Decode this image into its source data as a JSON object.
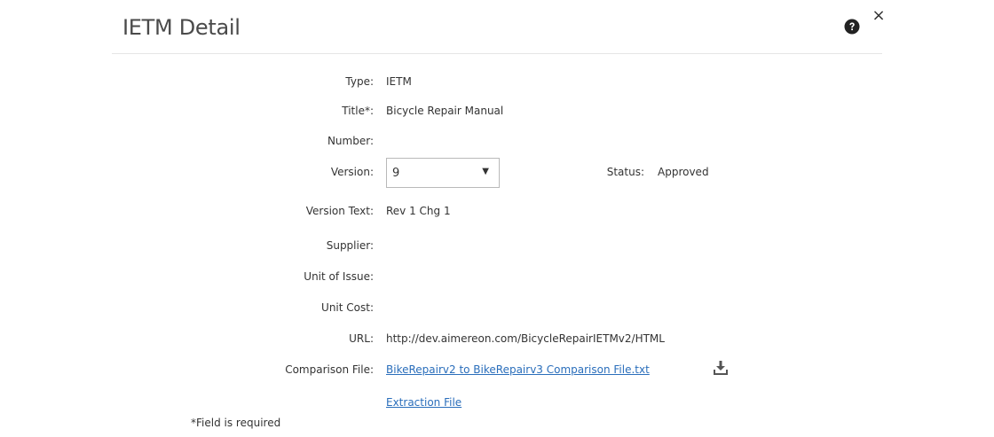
{
  "modal": {
    "title": "IETM Detail",
    "icons": {
      "help": "question-circle-icon",
      "close": "close-icon",
      "download": "download-icon"
    },
    "close_glyph": "×"
  },
  "fields": {
    "type": {
      "label": "Type:",
      "value": "IETM"
    },
    "title": {
      "label": "Title*:",
      "value": "Bicycle Repair Manual"
    },
    "number": {
      "label": "Number:",
      "value": ""
    },
    "version": {
      "label": "Version:",
      "value": "9"
    },
    "status": {
      "label": "Status:",
      "value": "Approved"
    },
    "version_text": {
      "label": "Version Text:",
      "value": "Rev 1 Chg 1"
    },
    "supplier": {
      "label": "Supplier:",
      "value": ""
    },
    "unit_of_issue": {
      "label": "Unit of Issue:",
      "value": ""
    },
    "unit_cost": {
      "label": "Unit Cost:",
      "value": ""
    },
    "url": {
      "label": "URL:",
      "value": "http://dev.aimereon.com/BicycleRepairIETMv2/HTML"
    },
    "comparison_file": {
      "label": "Comparison File:",
      "value": "BikeRepairv2 to BikeRepairv3 Comparison File.txt"
    },
    "extraction_file": {
      "value": "Extraction File"
    }
  },
  "footer": {
    "required_note": "*Field is required"
  },
  "colors": {
    "link": "#2a6ebb",
    "divider": "#e5e5e5",
    "title": "#4a4a4a"
  }
}
